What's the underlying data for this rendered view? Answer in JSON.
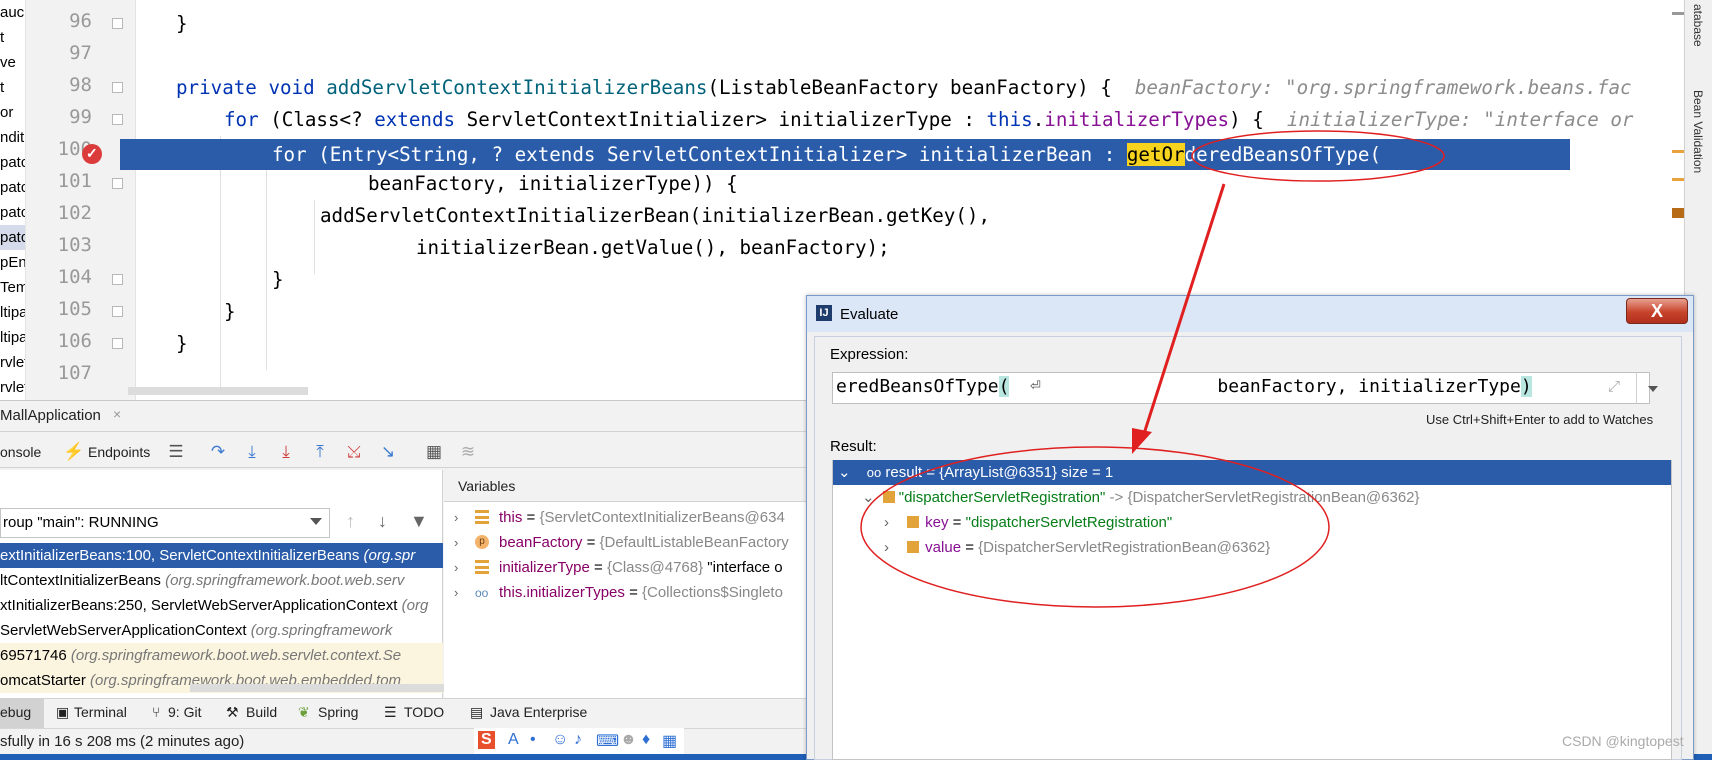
{
  "editor": {
    "line_numbers": [
      "96",
      "97",
      "98",
      "99",
      "100",
      "101",
      "102",
      "103",
      "104",
      "105",
      "106",
      "107"
    ],
    "lines": {
      "l96": "}",
      "l98_kw1": "private",
      "l98_kw2": "void",
      "l98_fn": "addServletContextInitializerBeans",
      "l98_rest": "(ListableBeanFactory beanFactory) {",
      "l98_hint": "beanFactory: \"org.springframework.beans.fac",
      "l99_kw1": "for",
      "l99_a": "(Class<?",
      "l99_kw2": "extends",
      "l99_b": "ServletContextInitializer> initializerType :",
      "l99_kw3": "this",
      "l99_dot": ".",
      "l99_fld": "initializerTypes",
      "l99_c": ") {",
      "l99_hint": "initializerType: \"interface or",
      "l100_a": "for (Entry<String, ? extends ServletContextInitializer> initializerBean : ",
      "l100_hl": "getOr",
      "l100_b": "deredBeansOfType(",
      "l101": "beanFactory, initializerType)) {",
      "l102": "addServletContextInitializerBean(initializerBean.getKey(),",
      "l103": "initializerBean.getValue(), beanFactory);",
      "l104": "}",
      "l105": "}",
      "l106": "}"
    },
    "left_strip_fragments": [
      "auc",
      "t",
      "ve",
      "t",
      "or",
      "ndit",
      "patc",
      "patc",
      "patc",
      "patc",
      "pEn",
      "Tem",
      "ltipa",
      "ltipa",
      "rvlet",
      "rvlet",
      "rvlet"
    ]
  },
  "right_strip": {
    "database_label": "atabase",
    "bean_validation_label": "Bean Validation"
  },
  "debug": {
    "run_tab": "MallApplication",
    "run_tab_close": "×",
    "toolbar": {
      "console": "onsole",
      "endpoints": "Endpoints"
    },
    "thread_select": "roup \"main\": RUNNING",
    "frames": [
      {
        "method": "extInitializerBeans:100, ServletContextInitializerBeans",
        "pkg": "(org.spr"
      },
      {
        "method": "ltContextInitializerBeans",
        "pkg": "(org.springframework.boot.web.serv"
      },
      {
        "method": "xtInitializerBeans:250, ServletWebServerApplicationContext",
        "pkg": "(org"
      },
      {
        "method": " ServletWebServerApplicationContext",
        "pkg": "(org.springframework"
      },
      {
        "method": "69571746",
        "pkg": "(org.springframework.boot.web.servlet.context.Se"
      },
      {
        "method": "omcatStarter",
        "pkg": "(org.springframework.boot.web.embedded.tom"
      }
    ],
    "variables_header": "Variables",
    "variables": [
      {
        "name": "this",
        "value": "{ServletContextInitializerBeans@634"
      },
      {
        "name": "beanFactory",
        "value": "{DefaultListableBeanFactory"
      },
      {
        "name": "initializerType",
        "value": "{Class@4768}",
        "extra": "\"interface o"
      },
      {
        "name": "this.initializerTypes",
        "value": "{Collections$Singleto"
      }
    ]
  },
  "tool_windows": {
    "debug": "ebug",
    "terminal": "Terminal",
    "git": "9: Git",
    "build": "Build",
    "spring": "Spring",
    "todo": "TODO",
    "java_enterprise": "Java Enterprise"
  },
  "status": {
    "text": "sfully in 16 s 208 ms (2 minutes ago)"
  },
  "evaluate": {
    "title": "Evaluate",
    "close": "X",
    "expression_label": "Expression:",
    "expression_left": "eredBeansOfType",
    "expression_open": "(",
    "expression_newline": "⏎",
    "expression_right": "beanFactory, initializerType",
    "expression_close": ")",
    "watch_hint": "Use Ctrl+Shift+Enter to add to Watches",
    "result_label": "Result:",
    "result_root": "result = {ArrayList@6351}  size = 1",
    "entry_key": "\"dispatcherServletRegistration\"",
    "entry_arrow": "->",
    "entry_value": "{DispatcherServletRegistrationBean@6362}",
    "key_name": "key",
    "key_value": "\"dispatcherServletRegistration\"",
    "value_name": "value",
    "value_value": "{DispatcherServletRegistrationBean@6362}"
  },
  "watermark": "CSDN @kingtopest",
  "colors": {
    "selection": "#2a5caa",
    "annotation_red": "#e02020",
    "keyword": "#0033b3",
    "field": "#871094",
    "string": "#067d17"
  }
}
